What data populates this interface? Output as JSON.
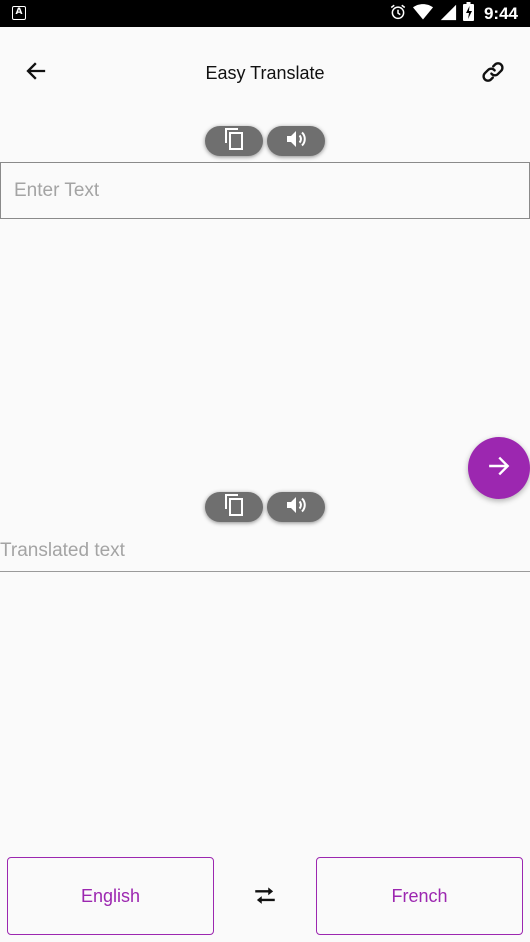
{
  "status_bar": {
    "notification_icon": "A",
    "time": "9:44",
    "icons": [
      "alarm-icon",
      "wifi-icon",
      "signal-icon",
      "battery-charging-icon"
    ]
  },
  "app_bar": {
    "title": "Easy Translate",
    "back_icon": "arrow-back-icon",
    "link_icon": "link-icon"
  },
  "source": {
    "placeholder": "Enter Text",
    "value": ""
  },
  "output": {
    "placeholder": "Translated text"
  },
  "controls": {
    "copy_icon": "copy-icon",
    "speak_icon": "volume-icon",
    "translate_icon": "arrow-forward-icon"
  },
  "languages": {
    "source": "English",
    "target": "French",
    "swap_icon": "swap-icon"
  },
  "colors": {
    "accent": "#9c27b0",
    "pill": "#6f6f6f",
    "background": "#fafafa"
  }
}
